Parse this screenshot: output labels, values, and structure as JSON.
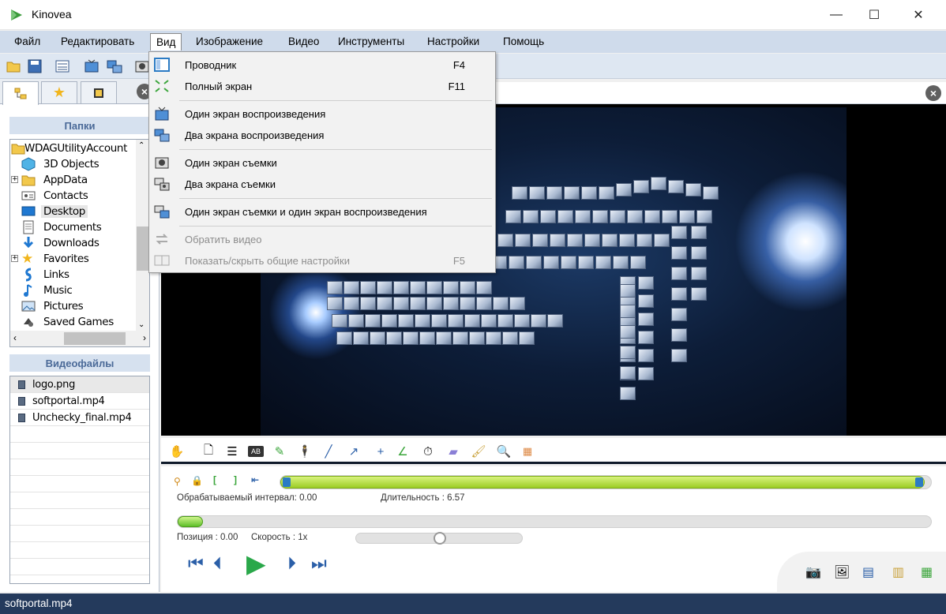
{
  "window": {
    "title": "Kinovea",
    "minimize": "—",
    "maximize": "☐",
    "close": "✕"
  },
  "menu": [
    "Файл",
    "Редактировать",
    "Вид",
    "Изображение",
    "Видео",
    "Инструменты",
    "Настройки",
    "Помощь"
  ],
  "dropdown": {
    "items": [
      {
        "label": "Проводник",
        "shortcut": "F4",
        "icon": "explorer-icon",
        "enabled": true
      },
      {
        "label": "Полный экран",
        "shortcut": "F11",
        "icon": "fullscreen-icon",
        "enabled": true
      },
      {
        "label": "Один экран воспроизведения",
        "shortcut": "",
        "icon": "one-playback-screen-icon",
        "enabled": true
      },
      {
        "label": "Два экрана воспроизведения",
        "shortcut": "",
        "icon": "two-playback-screens-icon",
        "enabled": true
      },
      {
        "label": "Один экран съемки",
        "shortcut": "",
        "icon": "one-capture-screen-icon",
        "enabled": true
      },
      {
        "label": "Два экрана съемки",
        "shortcut": "",
        "icon": "two-capture-screens-icon",
        "enabled": true
      },
      {
        "label": "Один экран съемки и один экран воспроизведения",
        "shortcut": "",
        "icon": "capture-and-playback-icon",
        "enabled": true
      },
      {
        "label": "Обратить видео",
        "shortcut": "",
        "icon": "swap-video-icon",
        "enabled": false
      },
      {
        "label": "Показать/скрыть общие настройки",
        "shortcut": "F5",
        "icon": "common-settings-icon",
        "enabled": false
      }
    ]
  },
  "left_panel": {
    "folders_title": "Папки",
    "videos_title": "Видеофайлы",
    "tree": [
      {
        "label": "WDAGUtilityAccount",
        "icon": "folder-icon",
        "selected": false
      },
      {
        "label": "3D Objects",
        "icon": "3d-objects-icon",
        "selected": false
      },
      {
        "label": "AppData",
        "icon": "folder-icon",
        "selected": false
      },
      {
        "label": "Contacts",
        "icon": "contacts-icon",
        "selected": false
      },
      {
        "label": "Desktop",
        "icon": "desktop-icon",
        "selected": true
      },
      {
        "label": "Documents",
        "icon": "documents-icon",
        "selected": false
      },
      {
        "label": "Downloads",
        "icon": "downloads-icon",
        "selected": false
      },
      {
        "label": "Favorites",
        "icon": "favorites-icon",
        "selected": false
      },
      {
        "label": "Links",
        "icon": "links-icon",
        "selected": false
      },
      {
        "label": "Music",
        "icon": "music-icon",
        "selected": false
      },
      {
        "label": "Pictures",
        "icon": "pictures-icon",
        "selected": false
      },
      {
        "label": "Saved Games",
        "icon": "saved-games-icon",
        "selected": false
      }
    ],
    "files": [
      {
        "label": "logo.png",
        "selected": true
      },
      {
        "label": "softportal.mp4",
        "selected": false
      },
      {
        "label": "Unchecky_final.mp4",
        "selected": false
      }
    ]
  },
  "player": {
    "interval_label": "Обрабатываемый интервал:  0.00",
    "duration_label": "Длительность : 6.57",
    "position_label": "Позиция : 0.00",
    "speed_label": "Скорость : 1x",
    "working_zone_fill": 0.99,
    "position_fraction": 0.0,
    "speed_fraction": 0.5
  },
  "status": {
    "filename": "softportal.mp4"
  }
}
